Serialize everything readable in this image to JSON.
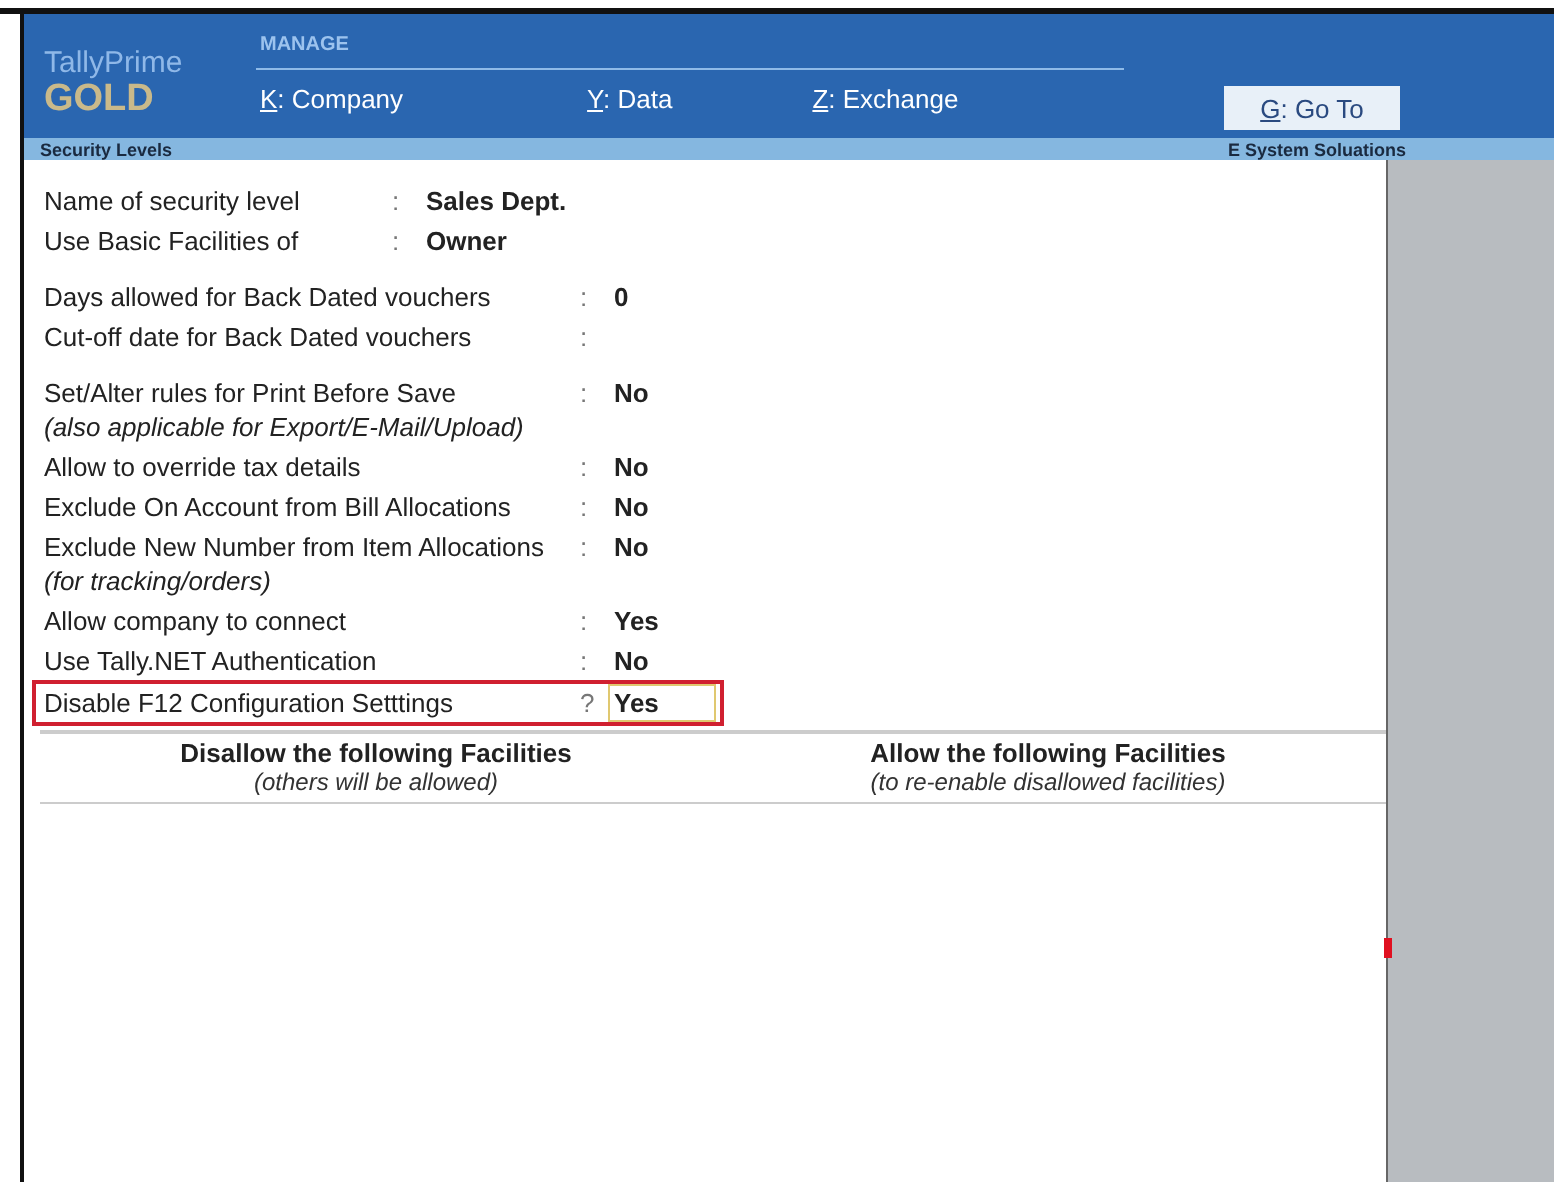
{
  "brand": {
    "product": "TallyPrime",
    "edition": "GOLD"
  },
  "menu": {
    "title": "MANAGE",
    "items": [
      {
        "key": "K",
        "label": ": Company"
      },
      {
        "key": "Y",
        "label": ": Data"
      },
      {
        "key": "Z",
        "label": ": Exchange"
      }
    ],
    "goto": {
      "key": "G",
      "label": ": Go To"
    }
  },
  "title_bar": {
    "title": "Security Levels",
    "company": "E System Soluations"
  },
  "groups": [
    [
      {
        "label": "Name of security level",
        "sep": ":",
        "value": "Sales Dept.",
        "highlighted": false,
        "focused": false
      },
      {
        "label": "Use Basic Facilities of",
        "sep": ":",
        "value": "Owner",
        "highlighted": false,
        "focused": false
      }
    ],
    [
      {
        "label": "Days allowed for Back Dated vouchers",
        "sep": ":",
        "value": "0",
        "highlighted": false,
        "focused": false
      },
      {
        "label": "Cut-off date for Back Dated vouchers",
        "sep": ":",
        "highlighted": false
      }
    ],
    [
      {
        "label": "Set/Alter rules for Print Before Save",
        "sep": ":",
        "value": "No",
        "note": "(also applicable for Export/E-Mail/Upload)",
        "highlighted": false,
        "focused": false
      },
      {
        "label": "Allow to override tax details",
        "sep": ":",
        "value": "No",
        "highlighted": false,
        "focused": false
      },
      {
        "label": "Exclude On Account from Bill Allocations",
        "sep": ":",
        "value": "No",
        "highlighted": false,
        "focused": false
      },
      {
        "label": "Exclude New Number from Item Allocations",
        "sep": ":",
        "value": "No",
        "note": "(for tracking/orders)",
        "highlighted": false,
        "focused": false
      },
      {
        "label": "Allow company to connect",
        "sep": ":",
        "value": "Yes",
        "highlighted": false,
        "focused": false
      },
      {
        "label": "Use Tally.NET Authentication",
        "sep": ":",
        "value": "No",
        "highlighted": false,
        "focused": false
      },
      {
        "label": "Disable F12 Configuration Setttings",
        "sep": "?",
        "value": "Yes",
        "highlighted": true,
        "focused": true
      }
    ]
  ],
  "facilities": [
    {
      "title": "Disallow the following Facilities",
      "subtitle": "(others will be allowed)"
    },
    {
      "title": "Allow the following Facilities",
      "subtitle": "(to re-enable disallowed facilities)"
    }
  ]
}
